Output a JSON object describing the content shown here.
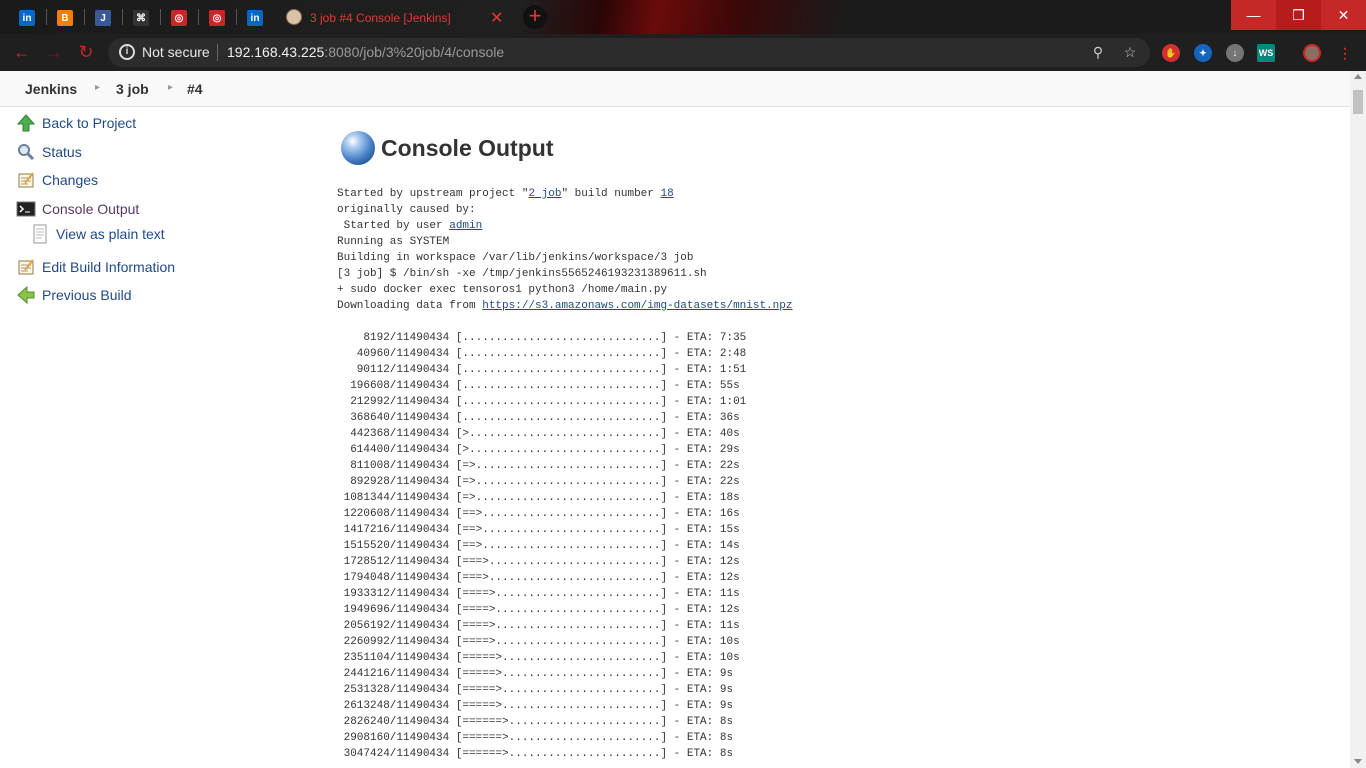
{
  "browser": {
    "active_tab_title": "3 job #4 Console [Jenkins]",
    "pinned_tabs": [
      {
        "icon": "linkedin-icon",
        "glyph": "in",
        "color": "#0a66c2"
      },
      {
        "icon": "blogger-icon",
        "glyph": "B",
        "color": "#f57d00"
      },
      {
        "icon": "jenkins-icon",
        "glyph": "J",
        "color": "#3b5998"
      },
      {
        "icon": "github-icon",
        "glyph": "⌘",
        "color": "#333333"
      },
      {
        "icon": "globe-icon",
        "glyph": "◎",
        "color": "#c62828"
      },
      {
        "icon": "globe-icon",
        "glyph": "◎",
        "color": "#c62828"
      },
      {
        "icon": "linkedin-icon",
        "glyph": "in",
        "color": "#0a66c2"
      }
    ],
    "security_label": "Not secure",
    "url_host": "192.168.43.225",
    "url_rest": ":8080/job/3%20job/4/console",
    "extension_ws_label": "WS"
  },
  "breadcrumb": {
    "items": [
      "Jenkins",
      "3 job",
      "#4"
    ]
  },
  "sidebar": {
    "back_to_project": "Back to Project",
    "status": "Status",
    "changes": "Changes",
    "console_output": "Console Output",
    "view_plain_text": "View as plain text",
    "edit_build_info": "Edit Build Information",
    "previous_build": "Previous Build"
  },
  "main": {
    "title": "Console Output",
    "header": {
      "l1_pre": "Started by upstream project \"",
      "l1_project": "2 job",
      "l1_mid": "\" build number ",
      "l1_build": "18",
      "l2": "originally caused by:",
      "l3_pre": " Started by user ",
      "l3_user": "admin",
      "l4": "Running as SYSTEM",
      "l5": "Building in workspace /var/lib/jenkins/workspace/3 job",
      "l6": "[3 job] $ /bin/sh -xe /tmp/jenkins5565246193231389611.sh",
      "l7": "+ sudo docker exec tensoros1 python3 /home/main.py",
      "l8_pre": "Downloading data from ",
      "l8_link": "https://s3.amazonaws.com/img-datasets/mnist.npz"
    },
    "progress_lines": [
      "    8192/11490434 [..............................] - ETA: 7:35",
      "   40960/11490434 [..............................] - ETA: 2:48",
      "   90112/11490434 [..............................] - ETA: 1:51",
      "  196608/11490434 [..............................] - ETA: 55s",
      "  212992/11490434 [..............................] - ETA: 1:01",
      "  368640/11490434 [..............................] - ETA: 36s",
      "  442368/11490434 [>.............................] - ETA: 40s",
      "  614400/11490434 [>.............................] - ETA: 29s",
      "  811008/11490434 [=>............................] - ETA: 22s",
      "  892928/11490434 [=>............................] - ETA: 22s",
      " 1081344/11490434 [=>............................] - ETA: 18s",
      " 1220608/11490434 [==>...........................] - ETA: 16s",
      " 1417216/11490434 [==>...........................] - ETA: 15s",
      " 1515520/11490434 [==>...........................] - ETA: 14s",
      " 1728512/11490434 [===>..........................] - ETA: 12s",
      " 1794048/11490434 [===>..........................] - ETA: 12s",
      " 1933312/11490434 [====>.........................] - ETA: 11s",
      " 1949696/11490434 [====>.........................] - ETA: 12s",
      " 2056192/11490434 [====>.........................] - ETA: 11s",
      " 2260992/11490434 [====>.........................] - ETA: 10s",
      " 2351104/11490434 [=====>........................] - ETA: 10s",
      " 2441216/11490434 [=====>........................] - ETA: 9s",
      " 2531328/11490434 [=====>........................] - ETA: 9s",
      " 2613248/11490434 [=====>........................] - ETA: 9s",
      " 2826240/11490434 [======>.......................] - ETA: 8s",
      " 2908160/11490434 [======>.......................] - ETA: 8s",
      " 3047424/11490434 [======>.......................] - ETA: 8s"
    ]
  }
}
